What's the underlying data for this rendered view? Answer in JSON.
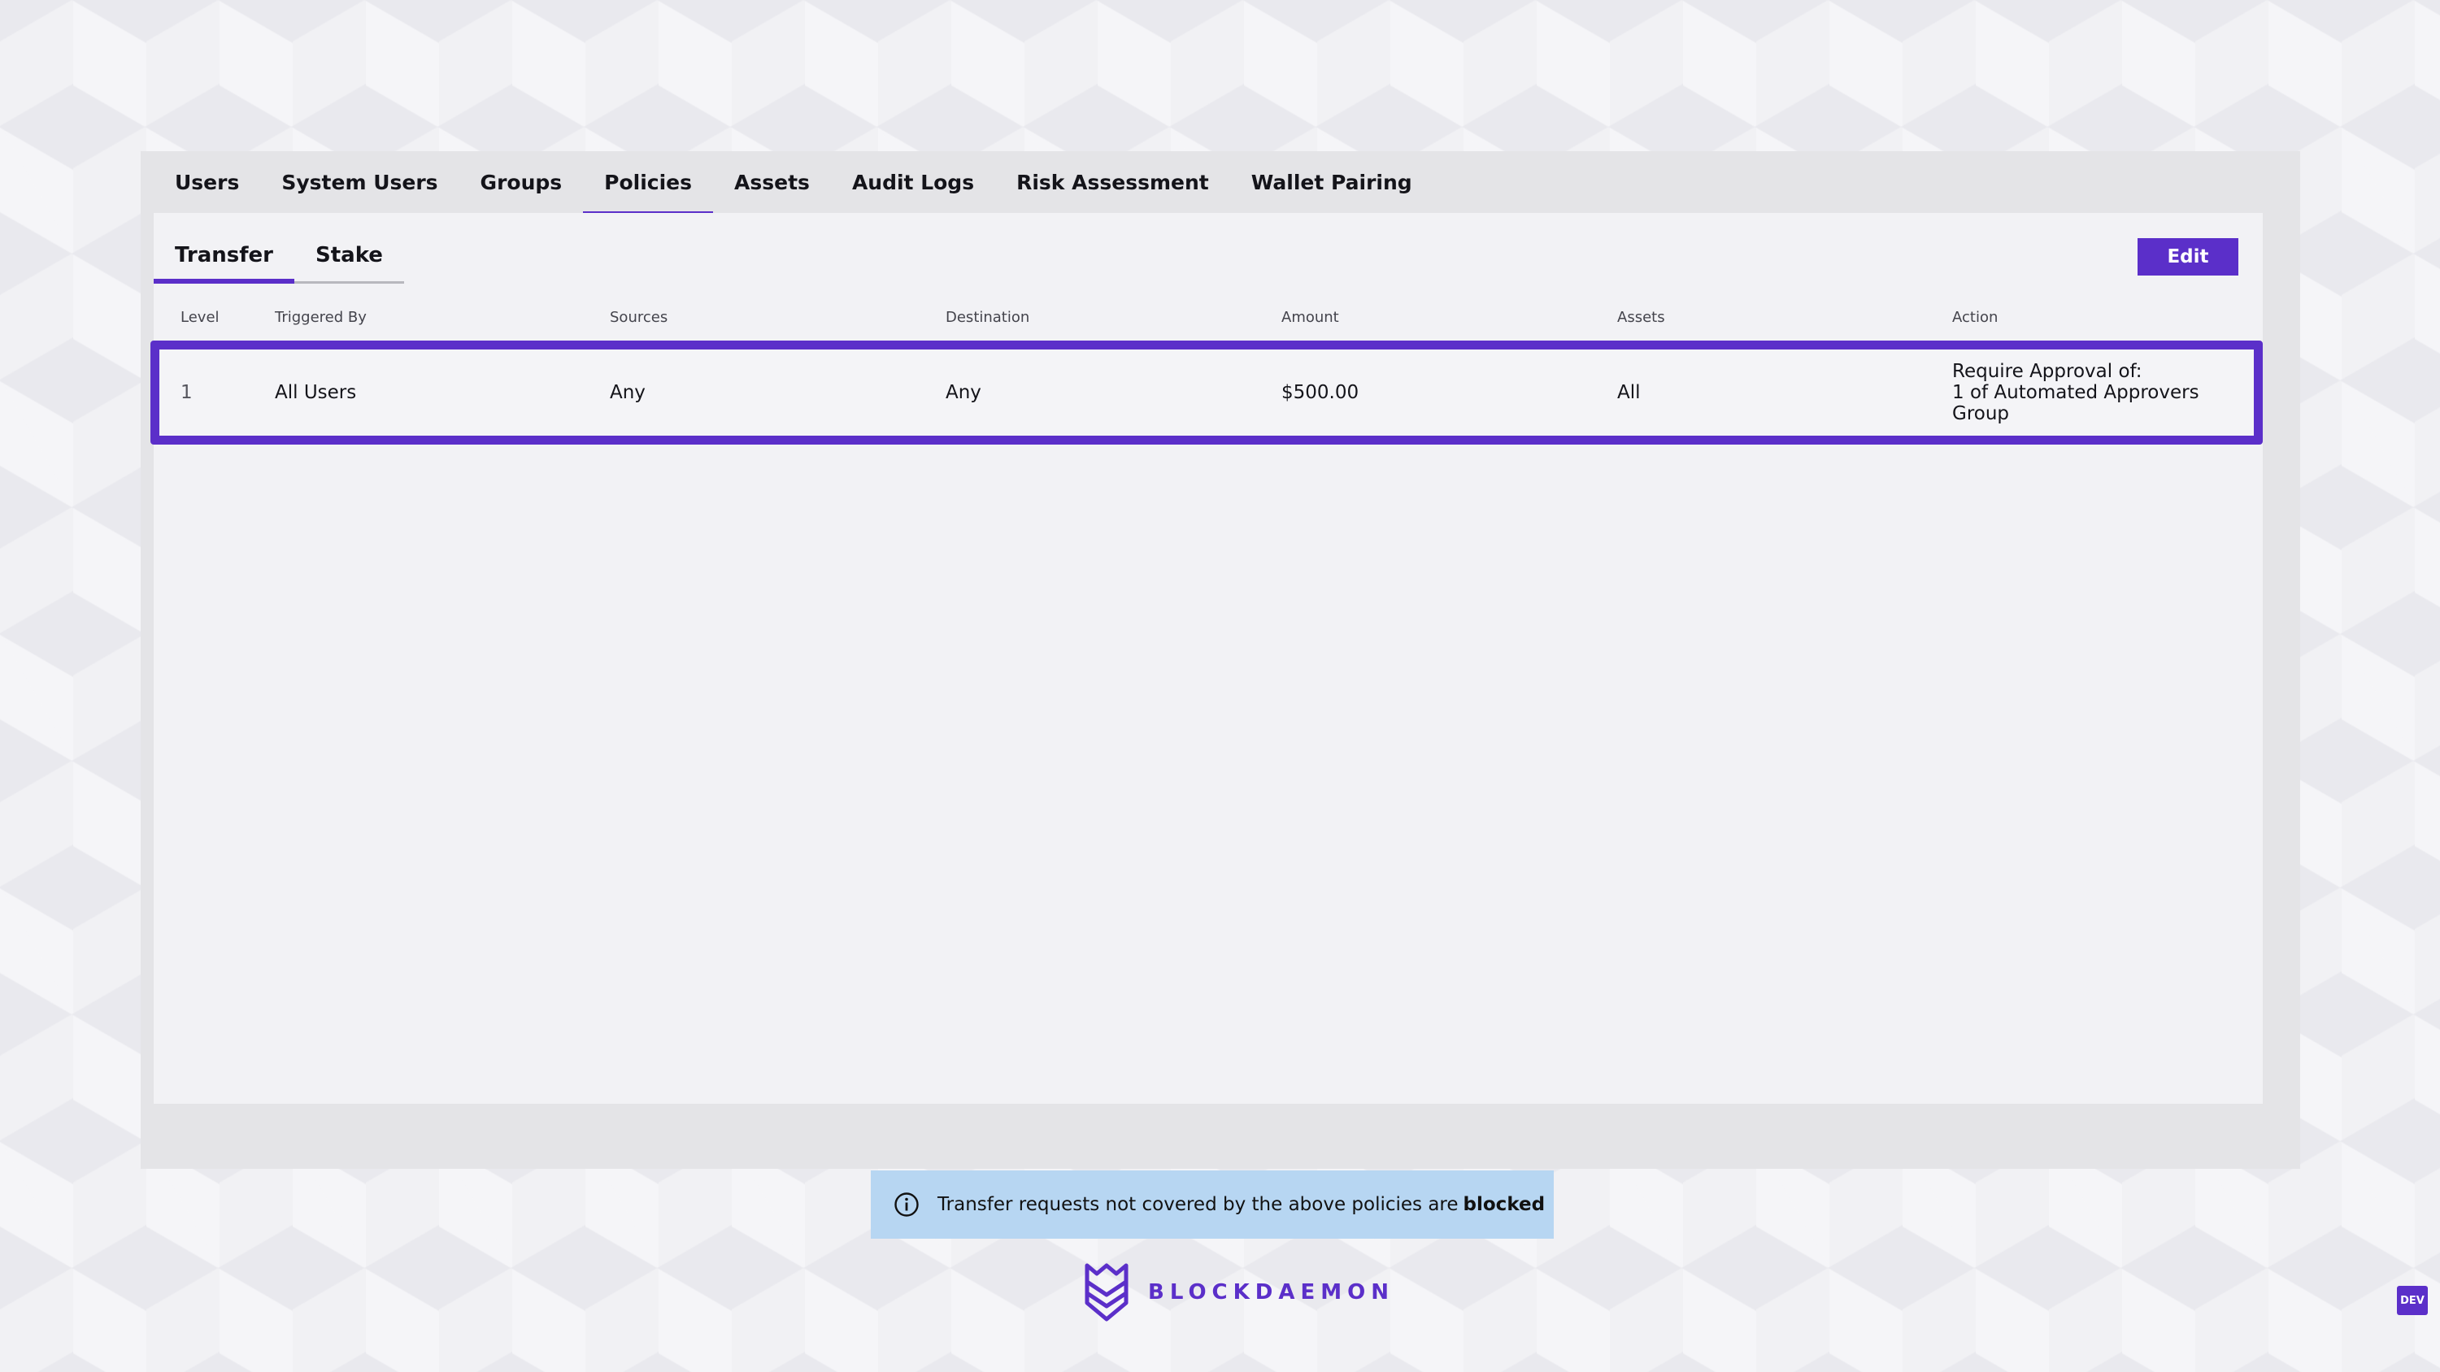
{
  "main_tabs": [
    {
      "label": "Users",
      "active": false
    },
    {
      "label": "System Users",
      "active": false
    },
    {
      "label": "Groups",
      "active": false
    },
    {
      "label": "Policies",
      "active": true
    },
    {
      "label": "Assets",
      "active": false
    },
    {
      "label": "Audit Logs",
      "active": false
    },
    {
      "label": "Risk Assessment",
      "active": false
    },
    {
      "label": "Wallet Pairing",
      "active": false
    }
  ],
  "sub_tabs": [
    {
      "label": "Transfer",
      "active": true
    },
    {
      "label": "Stake",
      "active": false
    }
  ],
  "edit_label": "Edit",
  "table": {
    "columns": [
      "Level",
      "Triggered By",
      "Sources",
      "Destination",
      "Amount",
      "Assets",
      "Action"
    ],
    "rows": [
      {
        "level": "1",
        "triggered_by": "All Users",
        "sources": "Any",
        "destination": "Any",
        "amount": "$500.00",
        "assets": "All",
        "action_lines": [
          "Require Approval of:",
          "1 of Automated Approvers",
          "Group"
        ]
      }
    ]
  },
  "info_banner": {
    "icon": "info-icon",
    "text": "Transfer requests not covered by the above policies are",
    "emphasis": "blocked"
  },
  "env_badge": "DEV",
  "brand": {
    "name": "BLOCKDAEMON",
    "icon": "blockdaemon-logo-icon",
    "color": "#5b2fc9"
  },
  "colors": {
    "accent": "#5b2fc9",
    "info_bg": "#b7d6f2",
    "panel": "#e4e4e7",
    "content": "#f2f2f5"
  }
}
